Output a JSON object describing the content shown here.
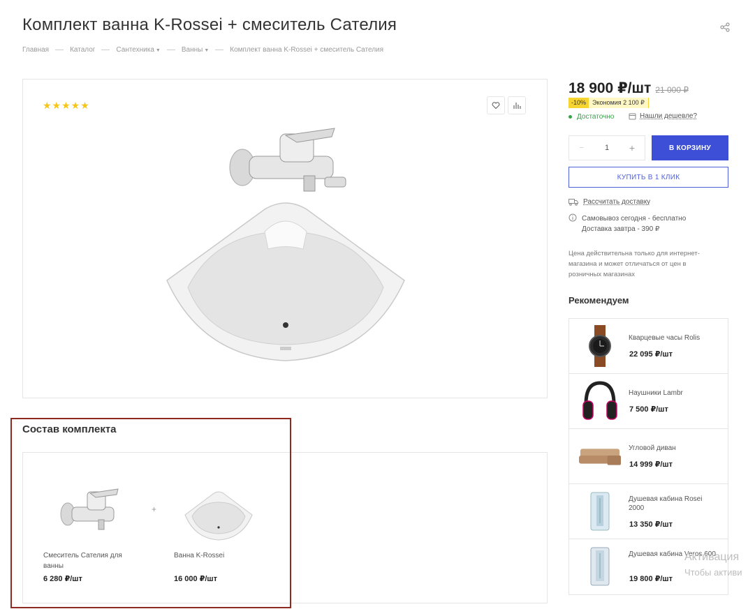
{
  "product": {
    "title": "Комплект ванна K-Rossei + смеситель Сателия",
    "rating_stars": "★★★★★",
    "price": "18 900 ₽/шт",
    "old_price": "21 000 ₽",
    "discount_percent": "-10%",
    "discount_saving": "Экономия 2 100 ₽",
    "stock_status": "Достаточно",
    "cheaper_link": "Нашли дешевле?",
    "quantity": "1",
    "qty_minus": "−",
    "qty_plus": "+",
    "cart_button": "В корзину",
    "one_click_button": "Купить в 1 клик",
    "delivery_link": "Рассчитать доставку",
    "pickup_line1": "Самовывоз сегодня - бесплатно",
    "pickup_line2": "Доставка завтра - 390 ₽",
    "price_note": "Цена действительна только для интернет-магазина и может отличаться от цен в розничных магазинах"
  },
  "breadcrumb": [
    {
      "label": "Главная"
    },
    {
      "label": "Каталог"
    },
    {
      "label": "Сантехника"
    },
    {
      "label": "Ванны"
    },
    {
      "label": "Комплект ванна K-Rossei + смеситель Сателия"
    }
  ],
  "recommend": {
    "title": "Рекомендуем",
    "items": [
      {
        "name": "Кварцевые часы Rolis",
        "price": "22 095 ₽/шт",
        "icon": "watch-icon"
      },
      {
        "name": "Наушники Lambr",
        "price": "7 500 ₽/шт",
        "icon": "headphones-icon"
      },
      {
        "name": "Угловой диван",
        "price": "14 999 ₽/шт",
        "icon": "sofa-icon"
      },
      {
        "name": "Душевая кабина Rosei 2000",
        "price": "13 350 ₽/шт",
        "icon": "shower-cabin-icon"
      },
      {
        "name": "Душевая кабина Veros 600",
        "price": "19 800 ₽/шт",
        "icon": "shower-cabin-icon"
      }
    ]
  },
  "kit": {
    "title": "Состав комплекта",
    "plus": "+",
    "items": [
      {
        "name": "Смеситель Сателия для ванны",
        "price": "6 280 ₽/шт"
      },
      {
        "name": "Ванна K-Rossei",
        "price": "16 000 ₽/шт"
      }
    ]
  },
  "watermark": {
    "line1": "Активация",
    "line2": "Чтобы активи"
  },
  "colors": {
    "accent": "#3c4fd6",
    "discount": "#f7d531",
    "stock": "#3aa14b",
    "stars": "#f5c518",
    "highlight": "#8e2a22"
  }
}
